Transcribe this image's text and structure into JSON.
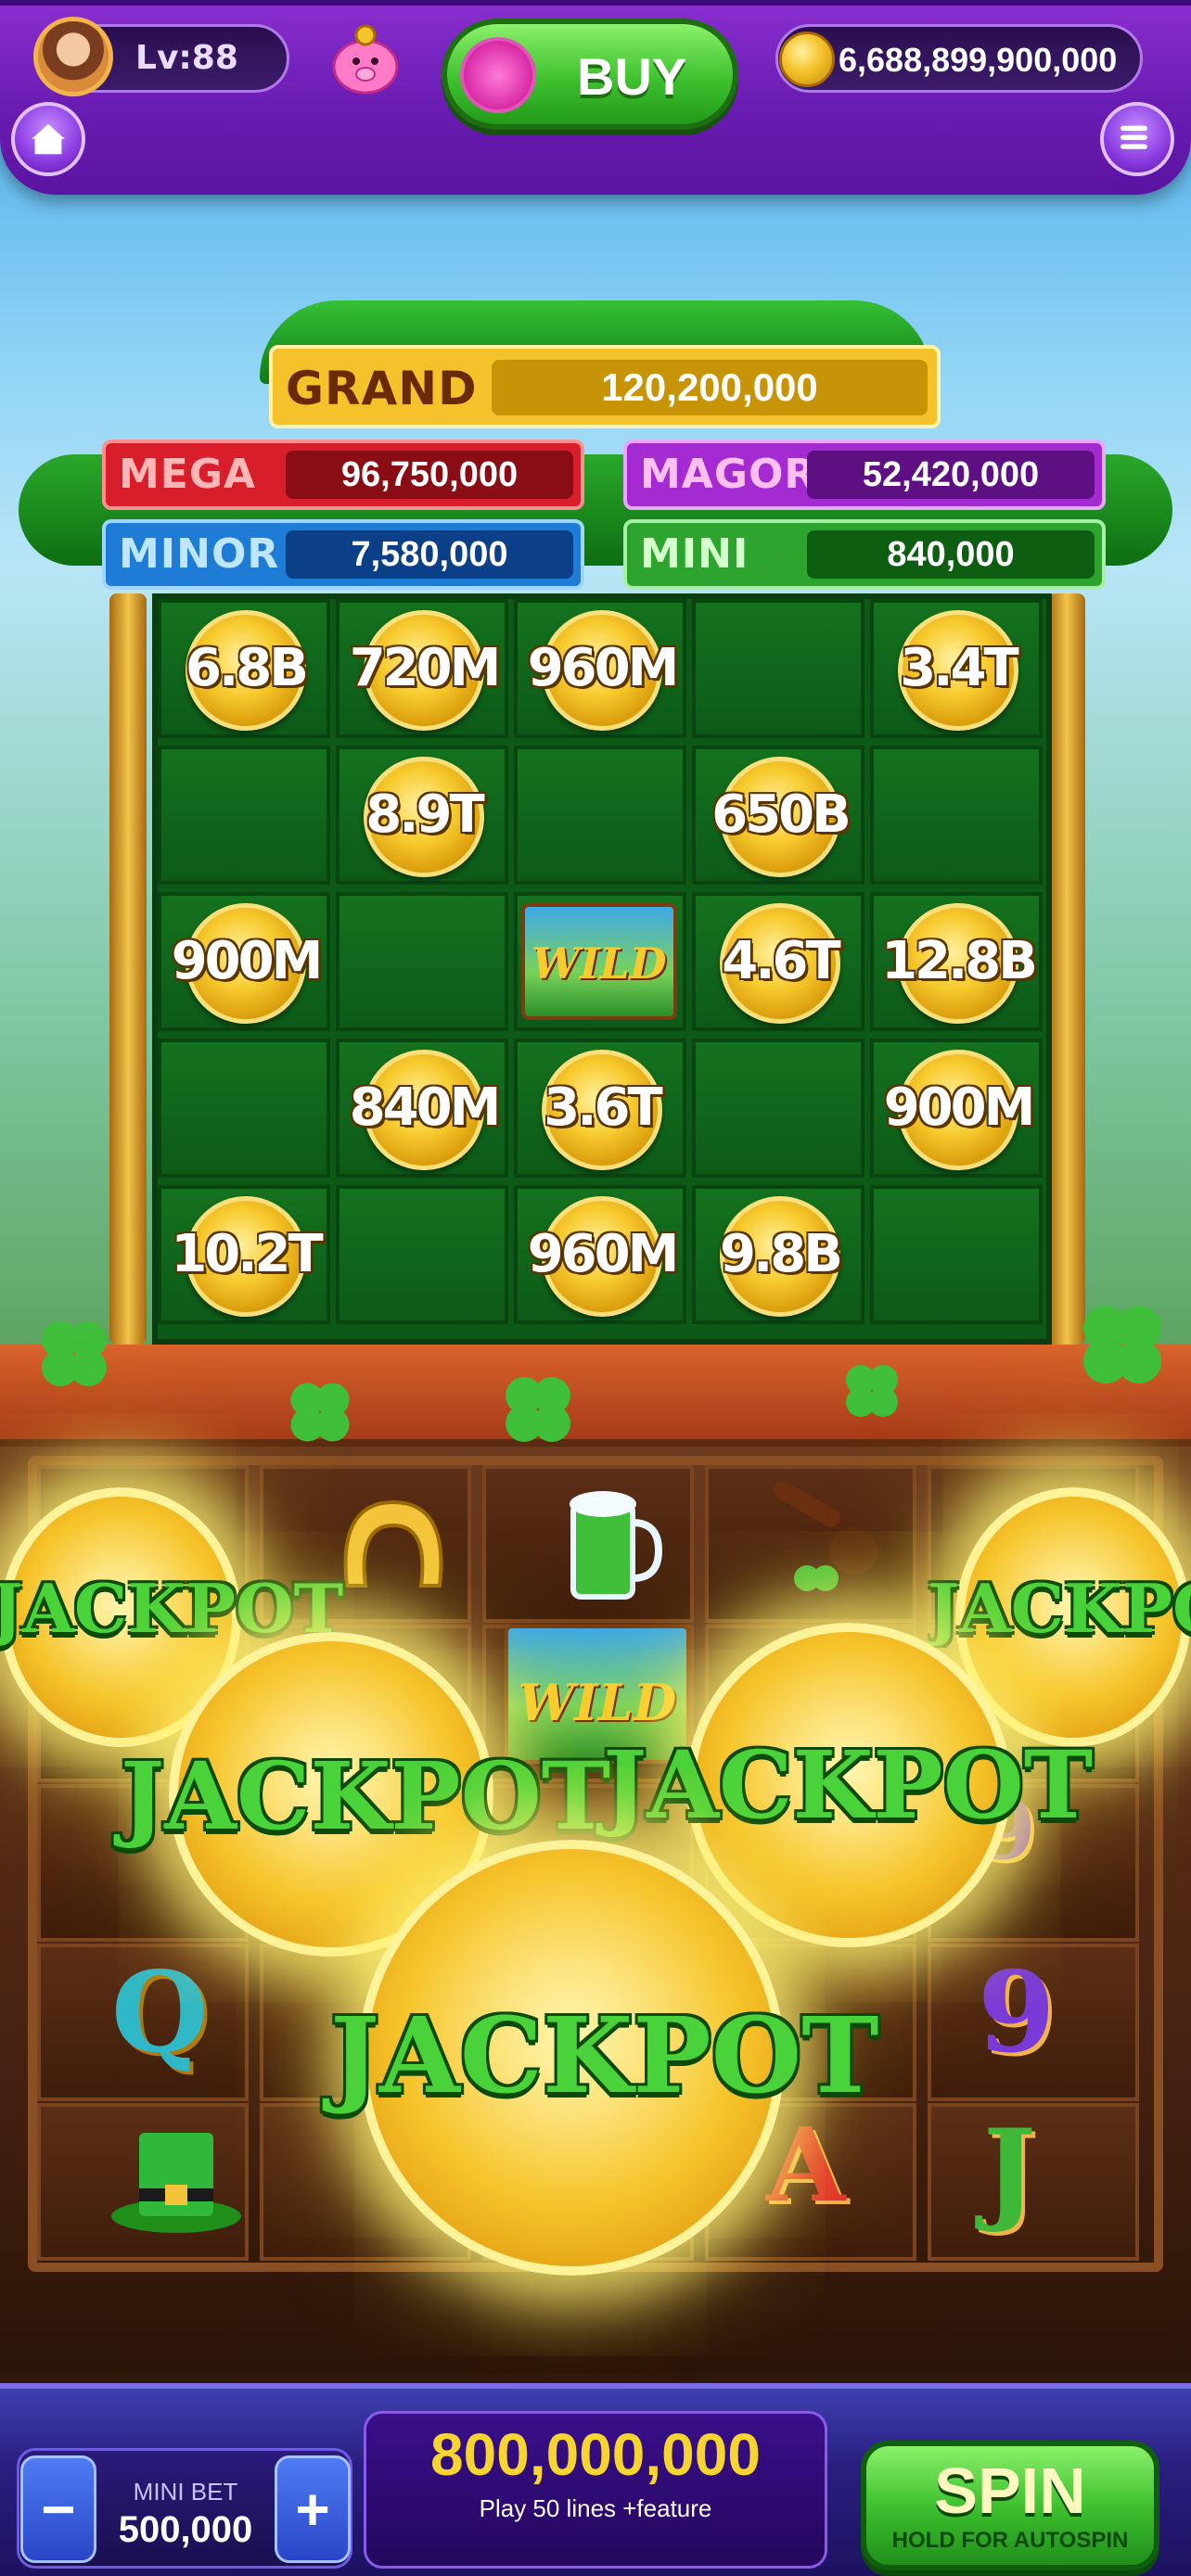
{
  "header": {
    "level": "Lv:88",
    "buy_label": "BUY",
    "coin_balance": "6,688,899,900,000"
  },
  "jackpots": {
    "grand": {
      "label": "GRAND",
      "value": "120,200,000"
    },
    "mega": {
      "label": "MEGA",
      "value": "96,750,000"
    },
    "major": {
      "label": "MAGOR",
      "value": "52,420,000"
    },
    "minor": {
      "label": "MINOR",
      "value": "7,580,000"
    },
    "mini": {
      "label": "MINI",
      "value": "840,000"
    }
  },
  "upper_board": {
    "cells": [
      "6.8B",
      "720M",
      "960M",
      "",
      "3.4T",
      "",
      "8.9T",
      "",
      "650B",
      "",
      "900M",
      "",
      "WILD",
      "4.6T",
      "12.8B",
      "",
      "840M",
      "3.6T",
      "",
      "900M",
      "10.2T",
      "",
      "960M",
      "9.8B",
      ""
    ]
  },
  "lower_reels": {
    "symbols": [
      "Q",
      "9",
      "A",
      "J",
      "9"
    ],
    "wild_label": "WILD",
    "jackpot_coins": [
      "JACKPOT",
      "JACKPOT",
      "JACKPOT",
      "JACKPOT",
      "JACKPOT"
    ]
  },
  "footer": {
    "bet_caption": "MINI BET",
    "bet_value": "500,000",
    "minus": "−",
    "plus": "+",
    "total_bet": "800,000,000",
    "lines_caption": "Play 50 lines +feature",
    "spin_label": "SPIN",
    "spin_sub": "HOLD FOR AUTOSPIN"
  },
  "colors": {
    "gold": "#f7cb2e",
    "green_board": "#0d5a18",
    "purple_bar": "#6a1cb2"
  }
}
